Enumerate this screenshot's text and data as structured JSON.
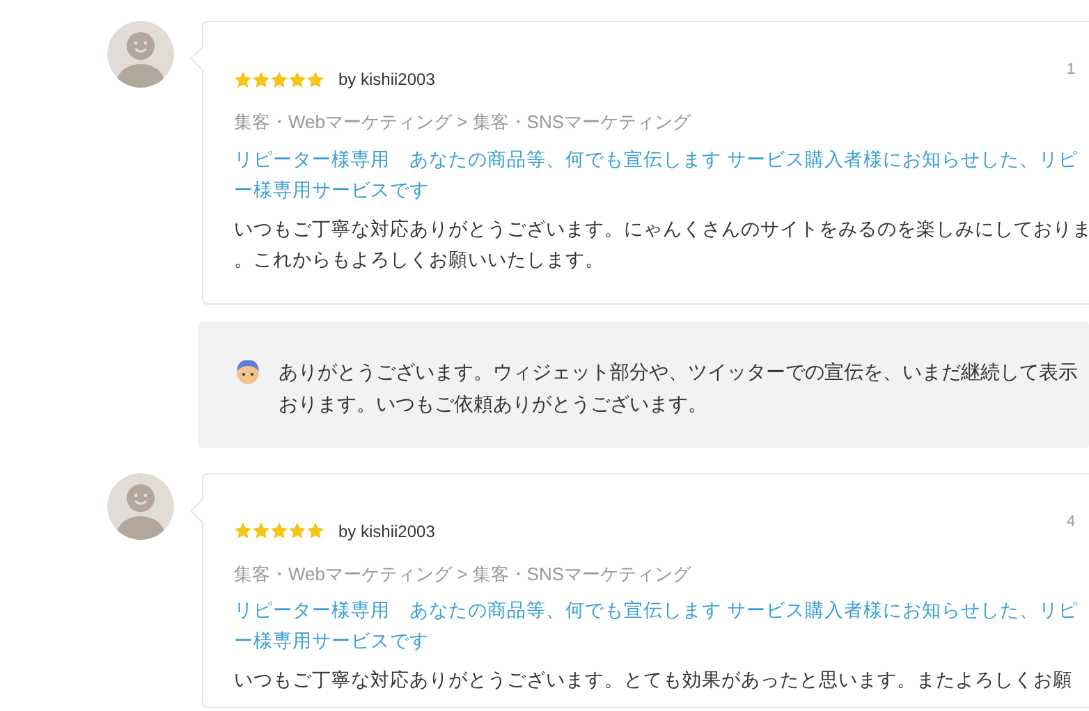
{
  "reviews": [
    {
      "stars": 5,
      "author": "by kishii2003",
      "date": "1",
      "category": "集客・Webマーケティング > 集客・SNSマーケティング",
      "service_lines": [
        "リピーター様専用　あなたの商品等、何でも宣伝します サービス購入者様にお知らせした、リピ",
        "ー様専用サービスです"
      ],
      "comment_lines": [
        "いつもご丁寧な対応ありがとうございます。にゃんくさんのサイトをみるのを楽しみにしておりま",
        "。これからもよろしくお願いいたします。"
      ],
      "reply_lines": [
        "ありがとうございます。ウィジェット部分や、ツイッターでの宣伝を、いまだ継続して表示",
        "おります。いつもご依頼ありがとうございます。"
      ]
    },
    {
      "stars": 5,
      "author": "by kishii2003",
      "date": "4",
      "category": "集客・Webマーケティング > 集客・SNSマーケティング",
      "service_lines": [
        "リピーター様専用　あなたの商品等、何でも宣伝します サービス購入者様にお知らせした、リピ",
        "ー様専用サービスです"
      ],
      "comment_lines": [
        "いつもご丁寧な対応ありがとうございます。とても効果があったと思います。またよろしくお願"
      ]
    }
  ]
}
